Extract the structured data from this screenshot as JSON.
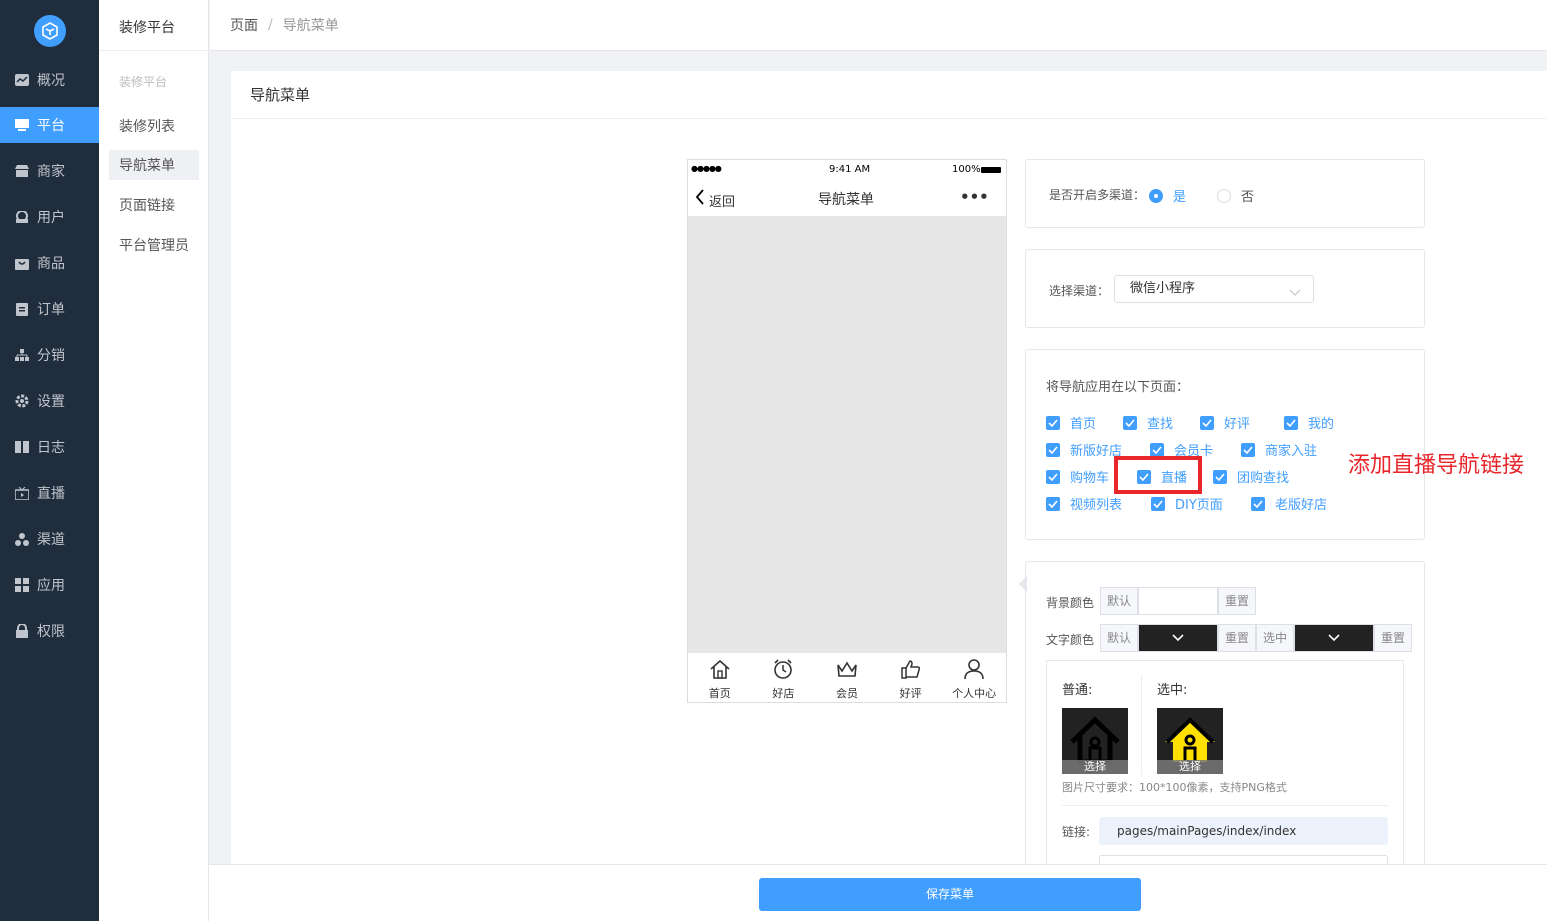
{
  "sidebar": {
    "items": [
      {
        "label": "概况",
        "icon": "chart-icon"
      },
      {
        "label": "平台",
        "icon": "monitor-icon",
        "active": true
      },
      {
        "label": "商家",
        "icon": "store-icon"
      },
      {
        "label": "用户",
        "icon": "user-icon"
      },
      {
        "label": "商品",
        "icon": "bag-icon"
      },
      {
        "label": "订单",
        "icon": "clipboard-icon"
      },
      {
        "label": "分销",
        "icon": "sitemap-icon"
      },
      {
        "label": "设置",
        "icon": "gear-icon"
      },
      {
        "label": "日志",
        "icon": "book-icon"
      },
      {
        "label": "直播",
        "icon": "live-icon"
      },
      {
        "label": "渠道",
        "icon": "cluster-icon"
      },
      {
        "label": "应用",
        "icon": "grid-icon"
      },
      {
        "label": "权限",
        "icon": "lock-icon"
      }
    ]
  },
  "subnav": {
    "title": "装修平台",
    "group": "装修平台",
    "items": [
      "装修列表",
      "导航菜单",
      "页面链接",
      "平台管理员"
    ]
  },
  "breadcrumb": {
    "root": "页面",
    "sep": "/",
    "current": "导航菜单"
  },
  "card": {
    "title": "导航菜单"
  },
  "phone": {
    "signal": "●●●●●",
    "time": "9:41 AM",
    "battery": "100%",
    "back": "返回",
    "title": "导航菜单",
    "more": "•••",
    "tabs": [
      "首页",
      "好店",
      "会员",
      "好评",
      "个人中心"
    ]
  },
  "multichannel": {
    "label": "是否开启多渠道：",
    "yes": "是",
    "no": "否"
  },
  "channel": {
    "label": "选择渠道：",
    "value": "微信小程序"
  },
  "pages": {
    "label": "将导航应用在以下页面：",
    "rows": [
      [
        "首页",
        "查找",
        "好评",
        "我的"
      ],
      [
        "新版好店",
        "会员卡",
        "商家入驻"
      ],
      [
        "购物车",
        "直播",
        "团购查找"
      ],
      [
        "视频列表",
        "DIY页面",
        "老版好店"
      ]
    ]
  },
  "annotation": "添加直播导航链接",
  "style": {
    "bg_label": "背景颜色",
    "text_label": "文字颜色",
    "default": "默认",
    "reset": "重置",
    "selected": "选中",
    "normal_label": "普通:",
    "selected_label": "选中:",
    "pick": "选择",
    "hint": "图片尺寸要求：100*100像素，支持PNG格式",
    "link_label": "链接:",
    "link_value": "pages/mainPages/index/index"
  },
  "save": "保存菜单",
  "colors": {
    "accent": "#409eff",
    "sidebar": "#1f2d3d",
    "highlight": "#e8262b",
    "yellow": "#ffe000"
  }
}
